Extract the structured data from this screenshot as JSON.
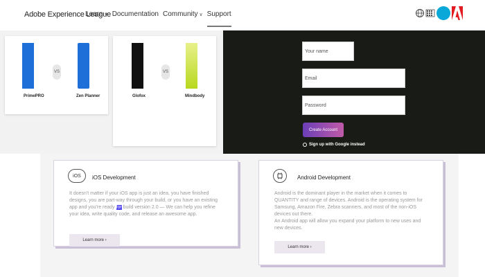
{
  "header": {
    "brand": "Adobe Experience League",
    "nav": [
      {
        "label": "Learn",
        "chevron": true
      },
      {
        "label": "Documentation",
        "chevron": false
      },
      {
        "label": "Community",
        "chevron": true
      },
      {
        "label": "Support",
        "chevron": false,
        "active": true
      }
    ],
    "icons": [
      "globe-icon",
      "flag-icon",
      "avatar",
      "adobe-logo"
    ],
    "accent": "#0aa8d8",
    "adobe_red": "#e31b23"
  },
  "comparisons": [
    {
      "left": {
        "name": "PrimePRO",
        "color": "#1e6fd8"
      },
      "vs": "VS",
      "right": {
        "name": "Zen Planner",
        "color": "#1e6fd8"
      }
    },
    {
      "left": {
        "name": "Glofox",
        "color": "#111111"
      },
      "vs": "VS",
      "right": {
        "name": "Mindbody",
        "color": "#b7d81e"
      }
    }
  ],
  "signup": {
    "name_placeholder": "Your name",
    "email_placeholder": "Email",
    "password_placeholder": "Password",
    "cta_label": "Create Account",
    "google_label": "Sign up with Google instead"
  },
  "services": [
    {
      "icon": "iOS",
      "title": "iOS Development",
      "text_before": "It doesn't matter if your iOS app is just an idea, you have finished designs, you are part-way through your build, or you have an existing app and you're ready ",
      "highlight": "for",
      "text_after": " build version 2.0 — We can help you refine your idea, write quality code, and release an awesome app.",
      "button": "Learn more ›"
    },
    {
      "icon": "android-icon",
      "title": "Android Development",
      "text": "Android is the dominant player in the market when it comes to QUANTITY and range of devices. Android is the operating system for Samsung, Amazon Fire, Zebra scanners, and most of the non-iOS devices out there.",
      "text2": "An Android app will allow you expand your platform to new uses and new devices.",
      "button": "Learn more ›"
    }
  ]
}
